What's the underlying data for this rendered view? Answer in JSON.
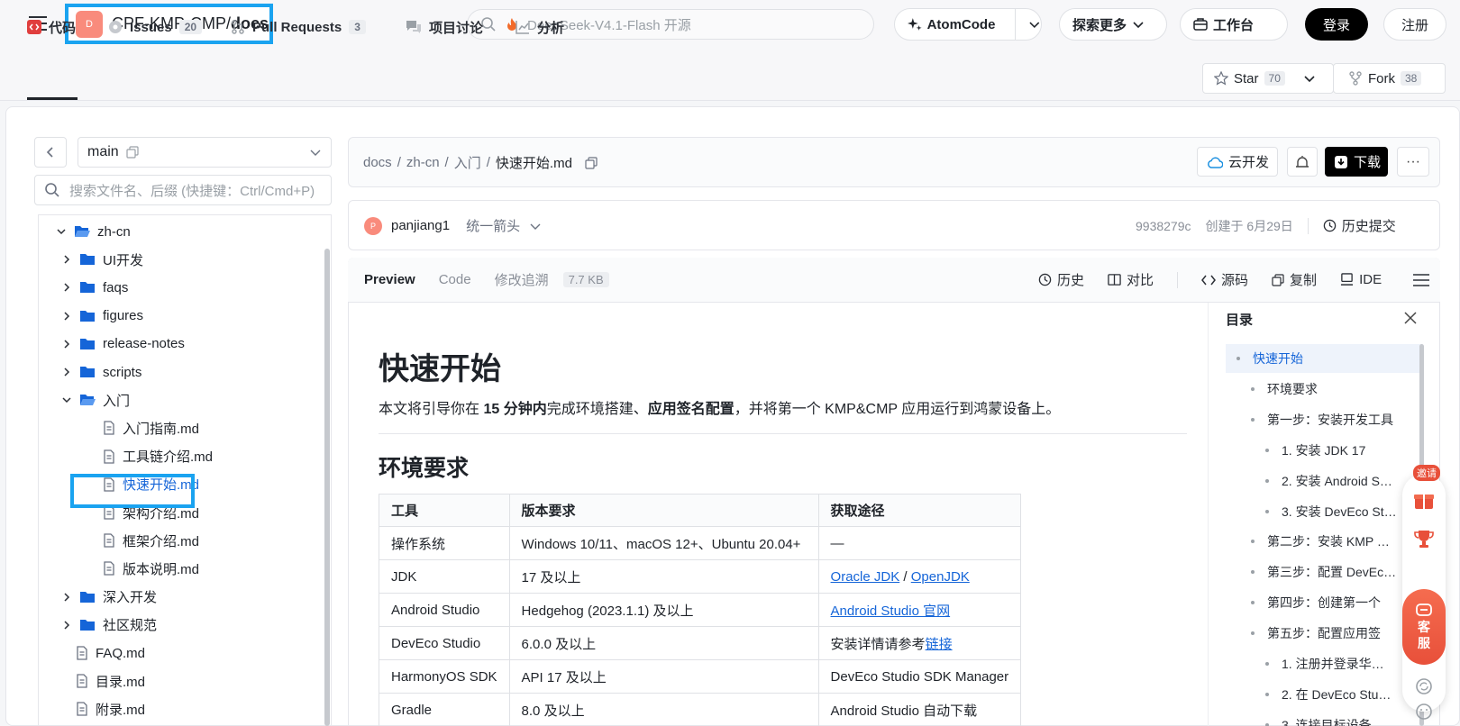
{
  "repo": {
    "avatar": "D",
    "owner_path": "CPF-KMP-CMP/",
    "name": "docs"
  },
  "search": {
    "placeholder": "DeepSeek-V4.1-Flash 开源"
  },
  "top_actions": {
    "atomcode": "AtomCode",
    "explore": "探索更多",
    "workbench": "工作台",
    "login": "登录",
    "register": "注册"
  },
  "tabs": [
    {
      "label": "代码",
      "count": ""
    },
    {
      "label": "Issues",
      "count": "20"
    },
    {
      "label": "Pull Requests",
      "count": "3"
    },
    {
      "label": "项目讨论",
      "count": ""
    },
    {
      "label": "分析",
      "count": ""
    }
  ],
  "repo_stats": {
    "star_label": "Star",
    "star_count": "70",
    "fork_label": "Fork",
    "fork_count": "38"
  },
  "sidebar": {
    "branch": "main",
    "search_placeholder": "搜索文件名、后缀 (快捷键：Ctrl/Cmd+P)",
    "tree": [
      {
        "label": "zh-cn",
        "type": "folder-open",
        "level": 0
      },
      {
        "label": "UI开发",
        "type": "folder",
        "level": 1
      },
      {
        "label": "faqs",
        "type": "folder",
        "level": 1
      },
      {
        "label": "figures",
        "type": "folder",
        "level": 1
      },
      {
        "label": "release-notes",
        "type": "folder",
        "level": 1
      },
      {
        "label": "scripts",
        "type": "folder",
        "level": 1
      },
      {
        "label": "入门",
        "type": "folder-open",
        "level": 1
      },
      {
        "label": "入门指南.md",
        "type": "file",
        "level": 2
      },
      {
        "label": "工具链介绍.md",
        "type": "file",
        "level": 2
      },
      {
        "label": "快速开始.md",
        "type": "file",
        "level": 2,
        "selected": true
      },
      {
        "label": "架构介绍.md",
        "type": "file",
        "level": 2
      },
      {
        "label": "框架介绍.md",
        "type": "file",
        "level": 2
      },
      {
        "label": "版本说明.md",
        "type": "file",
        "level": 2
      },
      {
        "label": "深入开发",
        "type": "folder",
        "level": 1
      },
      {
        "label": "社区规范",
        "type": "folder",
        "level": 1
      },
      {
        "label": "FAQ.md",
        "type": "file",
        "level": 1
      },
      {
        "label": "目录.md",
        "type": "file",
        "level": 1
      },
      {
        "label": "附录.md",
        "type": "file",
        "level": 1
      }
    ]
  },
  "breadcrumb": {
    "p1": "docs",
    "p2": "zh-cn",
    "p3": "入门",
    "current": "快速开始.md",
    "sep": "/"
  },
  "file_actions": {
    "cloud": "云开发",
    "download": "下载",
    "more": "···"
  },
  "commit": {
    "avatar": "P",
    "author": "panjiang1",
    "message": "统一箭头",
    "hash": "9938279c",
    "created": "创建于 6月29日",
    "history": "历史提交"
  },
  "viewer": {
    "tabs": [
      "Preview",
      "Code",
      "修改追溯"
    ],
    "size": "7.7 KB",
    "tools": {
      "history": "历史",
      "compare": "对比",
      "source": "源码",
      "copy": "复制",
      "ide": "IDE"
    }
  },
  "doc": {
    "h1": "快速开始",
    "intro_1": "本文将引导你在 ",
    "intro_b1": "15 分钟内",
    "intro_2": "完成环境搭建、",
    "intro_b2": "应用签名配置",
    "intro_3": "，并将第一个 KMP&CMP 应用运行到鸿蒙设备上。",
    "h2": "环境要求",
    "table": {
      "headers": [
        "工具",
        "版本要求",
        "获取途径"
      ],
      "rows": [
        {
          "tool": "操作系统",
          "version": "Windows 10/11、macOS 12+、Ubuntu 20.04+",
          "source": "—"
        },
        {
          "tool": "JDK",
          "version": "17 及以上",
          "link1": "Oracle JDK",
          "mid": " / ",
          "link2": "OpenJDK"
        },
        {
          "tool": "Android Studio",
          "version": "Hedgehog (2023.1.1) 及以上",
          "link1": "Android Studio 官网"
        },
        {
          "tool": "DevEco Studio",
          "version": "6.0.0 及以上",
          "source": "安装详情请参考",
          "link1": "链接"
        },
        {
          "tool": "HarmonyOS SDK",
          "version": "API 17 及以上",
          "source": "DevEco Studio SDK Manager"
        },
        {
          "tool": "Gradle",
          "version": "8.0 及以上",
          "source": "Android Studio 自动下载"
        }
      ]
    }
  },
  "toc": {
    "title": "目录",
    "items": [
      {
        "label": "快速开始",
        "level": 0,
        "active": true
      },
      {
        "label": "环境要求",
        "level": 1
      },
      {
        "label": "第一步：安装开发工具",
        "level": 1
      },
      {
        "label": "1. 安装 JDK 17",
        "level": 2
      },
      {
        "label": "2. 安装 Android S…",
        "level": 2
      },
      {
        "label": "3. 安装 DevEco St…",
        "level": 2
      },
      {
        "label": "第二步：安装 KMP …",
        "level": 1
      },
      {
        "label": "第三步：配置 DevEc…",
        "level": 1
      },
      {
        "label": "第四步：创建第一个",
        "level": 1
      },
      {
        "label": "第五步：配置应用签",
        "level": 1
      },
      {
        "label": "1. 注册并登录华…",
        "level": 2
      },
      {
        "label": "2. 在 DevEco Stu…",
        "level": 2
      },
      {
        "label": "3. 连接目标设备",
        "level": 2
      }
    ]
  },
  "floating": {
    "invite": "邀请",
    "kefu_1": "客",
    "kefu_2": "服"
  }
}
